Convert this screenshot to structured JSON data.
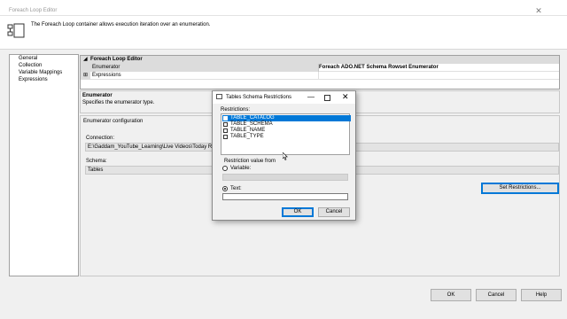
{
  "window": {
    "title": "Foreach Loop Editor",
    "close_glyph": "✕"
  },
  "header": {
    "description": "The Foreach Loop container allows execution iteration over an enumeration."
  },
  "nav": {
    "items": [
      "General",
      "Collection",
      "Variable Mappings",
      "Expressions"
    ]
  },
  "grid": {
    "category": "Foreach Loop Editor",
    "rows": [
      {
        "name": "Enumerator",
        "value": "Foreach ADO.NET Schema Rowset Enumerator"
      },
      {
        "name": "Expressions",
        "value": ""
      }
    ]
  },
  "description": {
    "title": "Enumerator",
    "text": "Specifies the enumerator type."
  },
  "config": {
    "title": "Enumerator configuration",
    "connection_label": "Connection:",
    "connection_value": "E:\\Gaddam_YouTube_Learning\\Live Videos\\Today Record",
    "schema_label": "Schema:",
    "schema_value": "Tables",
    "set_restrictions": "Set Restrictions..."
  },
  "dialog": {
    "title": "Tables Schema Restrictions",
    "restrictions_label": "Restrictions:",
    "restrictions": [
      {
        "label": "TABLE_CATALOG",
        "checked": false,
        "selected": true
      },
      {
        "label": "TABLE_SCHEMA",
        "checked": false,
        "selected": false
      },
      {
        "label": "TABLE_NAME",
        "checked": false,
        "selected": false
      },
      {
        "label": "TABLE_TYPE",
        "checked": false,
        "selected": false
      }
    ],
    "restriction_value_from": "Restriction value from",
    "variable_label": "Variable:",
    "text_label": "Text:",
    "text_value": "",
    "selected_source": "Text",
    "ok": "OK",
    "cancel": "Cancel"
  },
  "footer": {
    "ok": "OK",
    "cancel": "Cancel",
    "help": "Help"
  },
  "colors": {
    "selection": "#0078d7",
    "focus_border": "#0078d7"
  }
}
